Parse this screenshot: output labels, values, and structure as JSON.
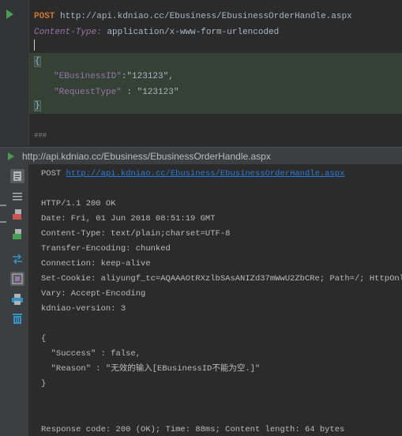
{
  "editor": {
    "request_method": "POST",
    "request_url": "http://api.kdniao.cc/Ebusiness/EbusinessOrderHandle.aspx",
    "header_name": "Content-Type:",
    "header_value": "application/x-www-form-urlencoded",
    "json_open": "{",
    "json_line1_key": "\"EBusinessID\"",
    "json_line1_rest": ":\"123123\",",
    "json_line2_key": "\"RequestType\"",
    "json_line2_rest": " : \"123123\"",
    "json_close": "}",
    "separator": "###"
  },
  "run_window": {
    "title": "http://api.kdniao.cc/Ebusiness/EbusinessOrderHandle.aspx",
    "toolbar_icons": [
      "soft-wrap-icon",
      "scroll-to-end-icon",
      "export-icon",
      "text-file-icon",
      "compare-icon",
      "toggle-view-icon",
      "print-icon",
      "trash-icon"
    ]
  },
  "console": {
    "post_label": "POST",
    "post_url": "http://api.kdniao.cc/Ebusiness/EbusinessOrderHandle.aspx",
    "status_line": "HTTP/1.1 200 OK",
    "date": "Date: Fri, 01 Jun 2018 08:51:19 GMT",
    "content_type": "Content-Type: text/plain;charset=UTF-8",
    "transfer_encoding": "Transfer-Encoding: chunked",
    "connection": "Connection: keep-alive",
    "set_cookie": "Set-Cookie: aliyungf_tc=AQAAAOtRXzlbSAsANIZd37mWwU2ZbCRe; Path=/; HttpOnly",
    "vary": "Vary: Accept-Encoding",
    "kdniao_version": "kdniao-version: 3",
    "body_open": "{",
    "body_success": "  \"Success\" : false,",
    "body_reason": "  \"Reason\" : \"无效的输入[EBusinessID不能为空.]\"",
    "body_close": "}",
    "footer": "Response code: 200 (OK); Time: 88ms; Content length: 64 bytes"
  },
  "colors": {
    "background": "#2b2b2b",
    "method_keyword": "#cc7832",
    "header_name": "#9876aa",
    "link": "#287bde",
    "run_green": "#499c54",
    "json_highlight": "#344134"
  }
}
